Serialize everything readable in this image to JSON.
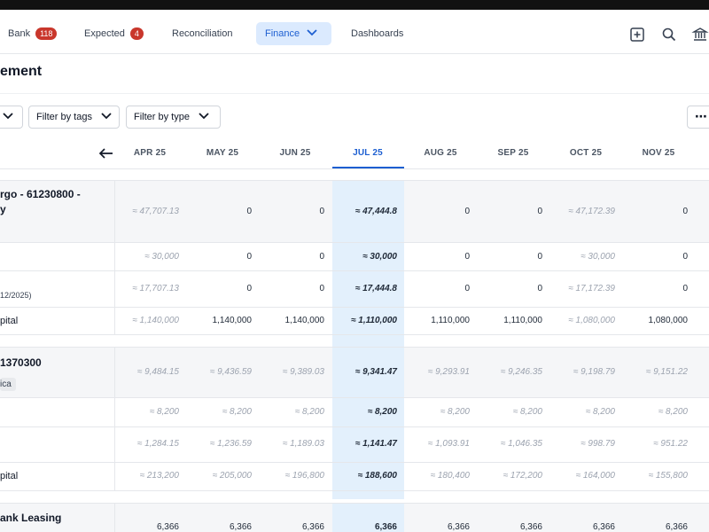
{
  "nav": {
    "items": [
      {
        "label": "Bank",
        "badge": "118"
      },
      {
        "label": "Expected",
        "badge": "4"
      },
      {
        "label": "Reconciliation"
      },
      {
        "label": "Finance"
      },
      {
        "label": "Dashboards"
      }
    ],
    "icons": [
      "add-square-icon",
      "search-icon",
      "institution-icon"
    ]
  },
  "page": {
    "title": "ement"
  },
  "filters": {
    "tags": "Filter by tags",
    "type": "Filter by type",
    "more": "⋯"
  },
  "months": [
    "APR 25",
    "MAY 25",
    "JUN 25",
    "JUL 25",
    "AUG 25",
    "SEP 25",
    "OCT 25",
    "NOV 25"
  ],
  "groups": [
    {
      "title_line1": "rgo - 61230800 -",
      "title_line2": "y",
      "rows": [
        {
          "label": "",
          "values": [
            "≈ 47,707.13",
            "0",
            "0",
            "≈ 47,444.8",
            "0",
            "0",
            "≈ 47,172.39",
            "0"
          ]
        },
        {
          "label": "",
          "values": [
            "≈ 30,000",
            "0",
            "0",
            "≈ 30,000",
            "0",
            "0",
            "≈ 30,000",
            "0"
          ]
        },
        {
          "label": "12/2025)",
          "values": [
            "≈ 17,707.13",
            "0",
            "0",
            "≈ 17,444.8",
            "0",
            "0",
            "≈ 17,172.39",
            "0"
          ]
        },
        {
          "label": "pital",
          "values": [
            "≈ 1,140,000",
            "1,140,000",
            "1,140,000",
            "≈ 1,110,000",
            "1,110,000",
            "1,110,000",
            "≈ 1,080,000",
            "1,080,000"
          ]
        }
      ]
    },
    {
      "title_line1": "1370300",
      "tag": "ica",
      "rows": [
        {
          "label": "",
          "values": [
            "≈ 9,484.15",
            "≈ 9,436.59",
            "≈ 9,389.03",
            "≈ 9,341.47",
            "≈ 9,293.91",
            "≈ 9,246.35",
            "≈ 9,198.79",
            "≈ 9,151.22"
          ]
        },
        {
          "label": "",
          "values": [
            "≈ 8,200",
            "≈ 8,200",
            "≈ 8,200",
            "≈ 8,200",
            "≈ 8,200",
            "≈ 8,200",
            "≈ 8,200",
            "≈ 8,200"
          ]
        },
        {
          "label": "",
          "values": [
            "≈ 1,284.15",
            "≈ 1,236.59",
            "≈ 1,189.03",
            "≈ 1,141.47",
            "≈ 1,093.91",
            "≈ 1,046.35",
            "≈ 998.79",
            "≈ 951.22"
          ]
        },
        {
          "label": "pital",
          "values": [
            "≈ 213,200",
            "≈ 205,000",
            "≈ 196,800",
            "≈ 188,600",
            "≈ 180,400",
            "≈ 172,200",
            "≈ 164,000",
            "≈ 155,800"
          ]
        }
      ]
    },
    {
      "title_line1": "ank Leasing",
      "rows": [
        {
          "label": "",
          "values": [
            "6,366",
            "6,366",
            "6,366",
            "6,366",
            "6,366",
            "6,366",
            "6,366",
            "6,366"
          ]
        }
      ]
    }
  ],
  "colors": {
    "accent": "#1d5fd1",
    "active_tab_bg": "#dbeafe",
    "badge": "#c9372c",
    "current_column_bg": "#e3f0fc",
    "group_bg": "#f5f6f8"
  }
}
